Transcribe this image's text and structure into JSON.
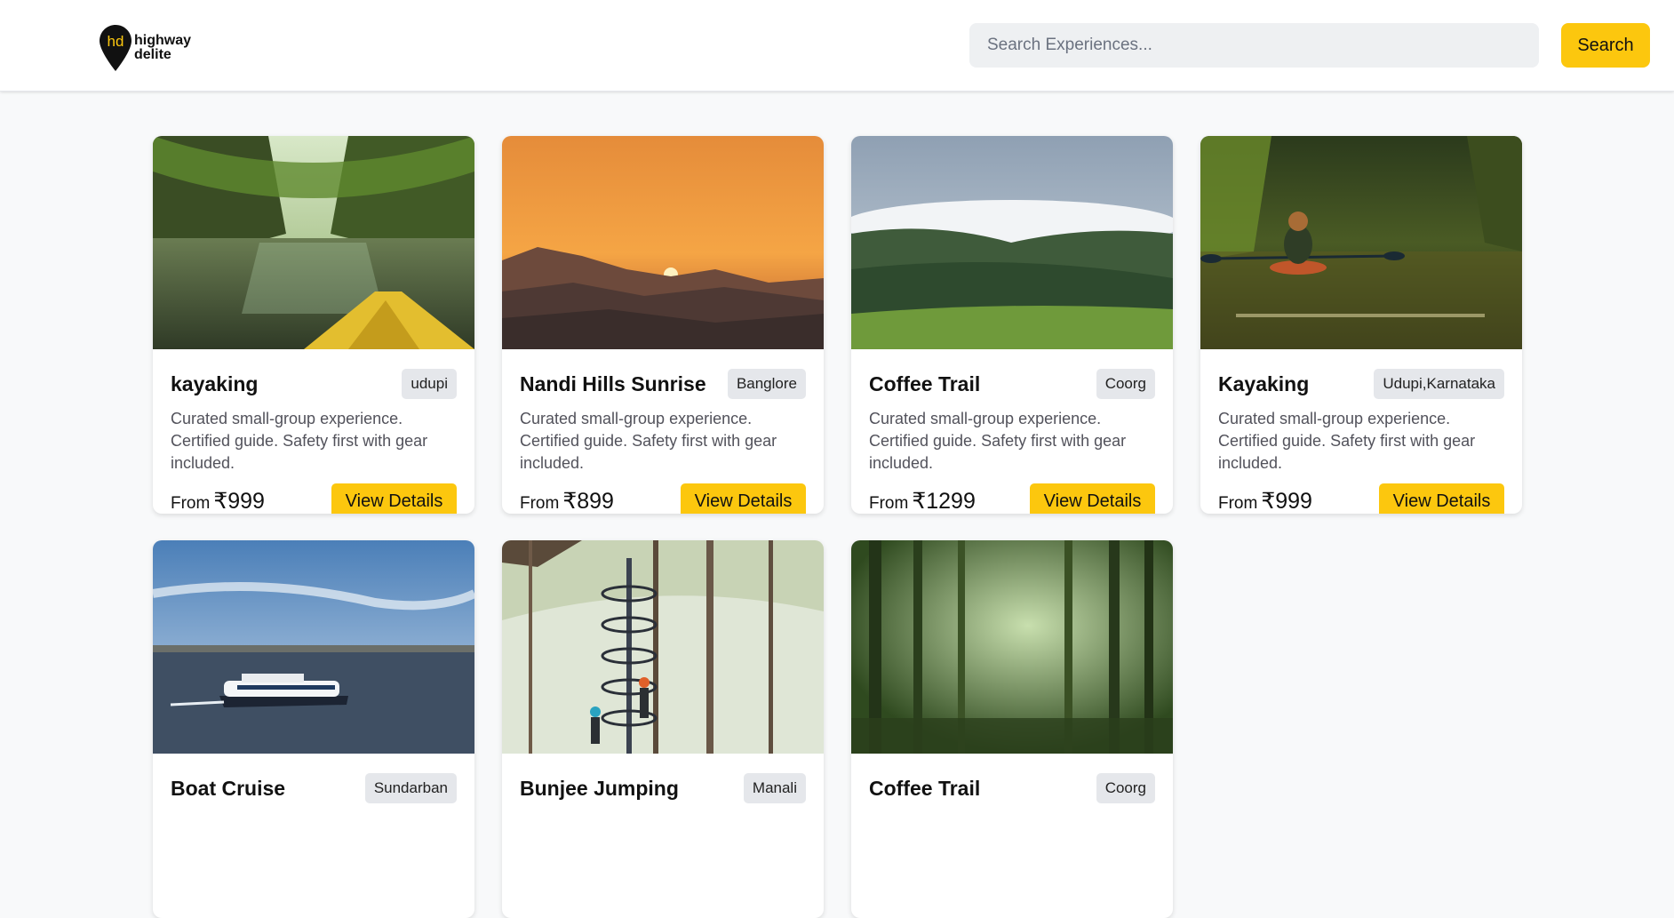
{
  "header": {
    "logo_line1": "highway",
    "logo_line2": "delite",
    "search_placeholder": "Search Experiences...",
    "search_button": "Search"
  },
  "colors": {
    "accent": "#fcc70e",
    "background": "#f8f9fa"
  },
  "cards": [
    {
      "title": "kayaking",
      "location": "udupi",
      "description": "Curated small-group experience. Certified guide. Safety first with gear included.",
      "price_prefix": "From",
      "price": "₹999",
      "button": "View Details"
    },
    {
      "title": "Nandi Hills Sunrise",
      "location": "Banglore",
      "description": "Curated small-group experience. Certified guide. Safety first with gear included.",
      "price_prefix": "From",
      "price": "₹899",
      "button": "View Details"
    },
    {
      "title": "Coffee Trail",
      "location": "Coorg",
      "description": "Curated small-group experience. Certified guide. Safety first with gear included.",
      "price_prefix": "From",
      "price": "₹1299",
      "button": "View Details"
    },
    {
      "title": "Kayaking",
      "location": "Udupi,Karnataka",
      "description": "Curated small-group experience. Certified guide. Safety first with gear included.",
      "price_prefix": "From",
      "price": "₹999",
      "button": "View Details"
    },
    {
      "title": "Boat Cruise",
      "location": "Sundarban"
    },
    {
      "title": "Bunjee Jumping",
      "location": "Manali"
    },
    {
      "title": "Coffee Trail",
      "location": "Coorg"
    }
  ]
}
